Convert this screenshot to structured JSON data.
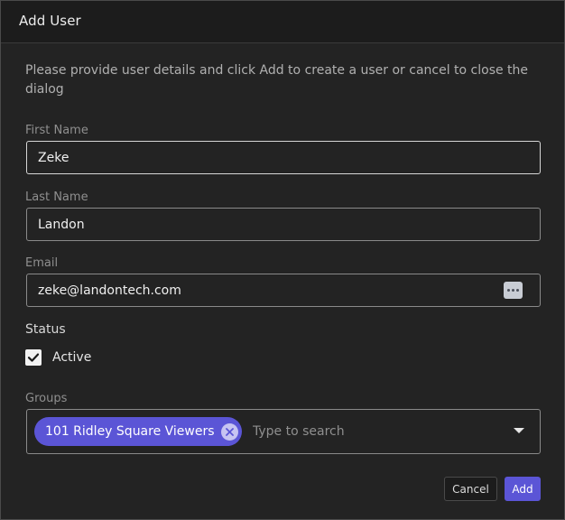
{
  "dialog": {
    "title": "Add User",
    "description": "Please provide user details and click Add to create a user or cancel to close the dialog"
  },
  "fields": {
    "first_name": {
      "label": "First Name",
      "value": "Zeke"
    },
    "last_name": {
      "label": "Last Name",
      "value": "Landon"
    },
    "email": {
      "label": "Email",
      "value": "zeke@landontech.com",
      "icon": "keyboard-dots-icon"
    }
  },
  "status": {
    "label": "Status",
    "active_label": "Active",
    "active_checked": true
  },
  "groups": {
    "label": "Groups",
    "selected": [
      "101 Ridley Square Viewers"
    ],
    "placeholder": "Type to search"
  },
  "actions": {
    "cancel_label": "Cancel",
    "add_label": "Add"
  },
  "colors": {
    "accent": "#5b55d6",
    "background": "#232323",
    "header": "#1c1c1c"
  }
}
